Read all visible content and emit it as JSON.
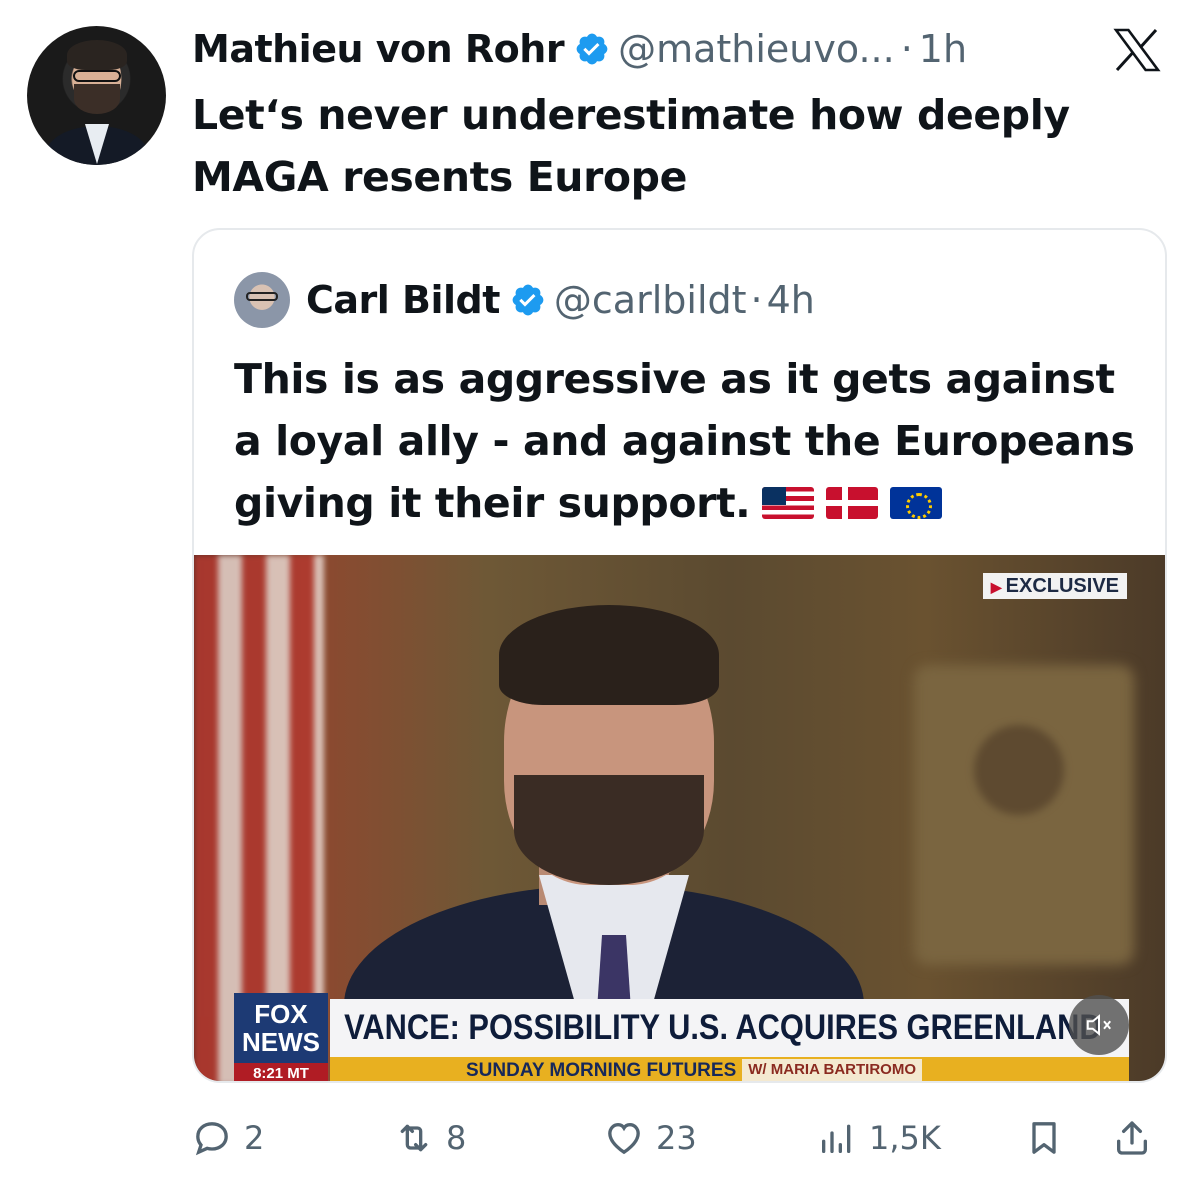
{
  "tweet": {
    "author_name": "Mathieu von Rohr",
    "handle": "@mathieuvo...",
    "time": "1h",
    "text": "Let‘s never underestimate how deeply MAGA resents Europe"
  },
  "quote": {
    "author_name": "Carl Bildt",
    "handle": "@carlbildt",
    "time": "4h",
    "text": "This is as aggressive as it gets against a loyal ally - and against the Europeans giving it their support.",
    "emojis": [
      "us-flag",
      "denmark-flag",
      "eu-flag"
    ]
  },
  "video": {
    "exclusive_label": "EXCLUSIVE",
    "network_line1": "FOX",
    "network_line2": "NEWS",
    "clock": "8:21 MT",
    "headline": "VANCE: POSSIBILITY U.S. ACQUIRES GREENLAND",
    "program": "SUNDAY MORNING FUTURES",
    "host": "W/ MARIA BARTIROMO",
    "muted": true
  },
  "stats": {
    "replies": "2",
    "reposts": "8",
    "likes": "23",
    "views": "1,5K"
  },
  "colors": {
    "text": "#0f1419",
    "secondary": "#536471",
    "verified": "#1d9bf0",
    "border": "#e6e9ec"
  }
}
